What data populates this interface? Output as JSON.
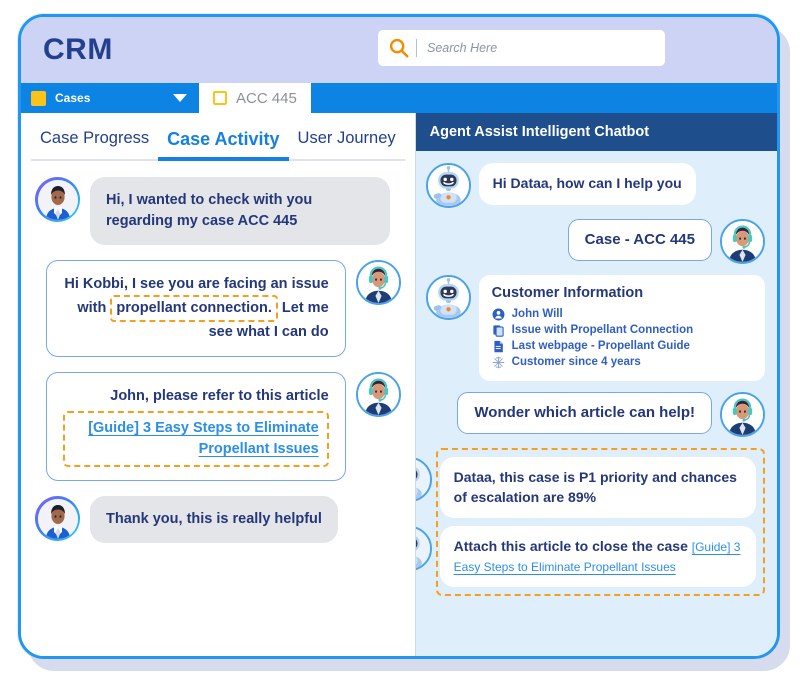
{
  "header": {
    "logo": "CRM",
    "search": {
      "placeholder": "Search Here",
      "value": "",
      "icon": "search-icon"
    }
  },
  "navstrip": {
    "select_label": "Cases",
    "select_icon": "yellow-square-icon",
    "caret_icon": "chevron-down-icon",
    "open_tab_label": "ACC 445",
    "open_tab_icon": "yellow-square-outline-icon"
  },
  "tabs": [
    {
      "label": "Case Progress",
      "active": false
    },
    {
      "label": "Case Activity",
      "active": true
    },
    {
      "label": "User Journey",
      "active": false
    }
  ],
  "left_chat": {
    "messages": [
      {
        "sender": "customer",
        "avatar": "customer-avatar",
        "style": "gray",
        "text": "Hi, I wanted to check with you regarding my case ACC 445"
      },
      {
        "sender": "agent",
        "avatar": "agent-avatar",
        "style": "outline",
        "text_before": "Hi Kobbi, I see you are facing an issue with",
        "highlight": "propellant connection.",
        "text_after": "Let me see what I can do"
      },
      {
        "sender": "agent",
        "avatar": "agent-avatar",
        "style": "outline",
        "text_before": "John, please refer to this article",
        "link": "[Guide] 3 Easy Steps to Eliminate Propellant Issues"
      },
      {
        "sender": "customer",
        "avatar": "customer-avatar",
        "style": "gray",
        "text": "Thank you, this is really helpful"
      }
    ]
  },
  "chatbot": {
    "title": "Agent Assist Intelligent Chatbot",
    "messages": [
      {
        "sender": "bot",
        "avatar": "bot-avatar",
        "style": "white",
        "text": "Hi Dataa, how can I help you"
      },
      {
        "sender": "agent",
        "avatar": "agent-avatar",
        "style": "outlined",
        "text": "Case - ACC 445"
      }
    ],
    "customer_card": {
      "title": "Customer Information",
      "rows": [
        {
          "icon": "person-icon",
          "text": "John Will"
        },
        {
          "icon": "documents-icon",
          "text": "Issue with Propellant Connection"
        },
        {
          "icon": "page-icon",
          "text": "Last webpage - Propellant Guide"
        },
        {
          "icon": "snowflake-icon",
          "text": "Customer since 4 years"
        }
      ]
    },
    "agent_question": "Wonder which article can help!",
    "suggestions": [
      {
        "text": "Dataa, this case is P1 priority and chances of escalation are 89%"
      },
      {
        "text": "Attach this article to close the case",
        "link": "[Guide] 3 Easy Steps to Eliminate Propellant Issues"
      }
    ]
  },
  "colors": {
    "brand_blue": "#0d84e3",
    "header_bg": "#ccd3f5",
    "navy": "#24377a",
    "accent_orange": "#f59f1b",
    "bot_header": "#1f4e8c",
    "link_blue": "#2b8fe8",
    "yellow": "#fcc419"
  }
}
